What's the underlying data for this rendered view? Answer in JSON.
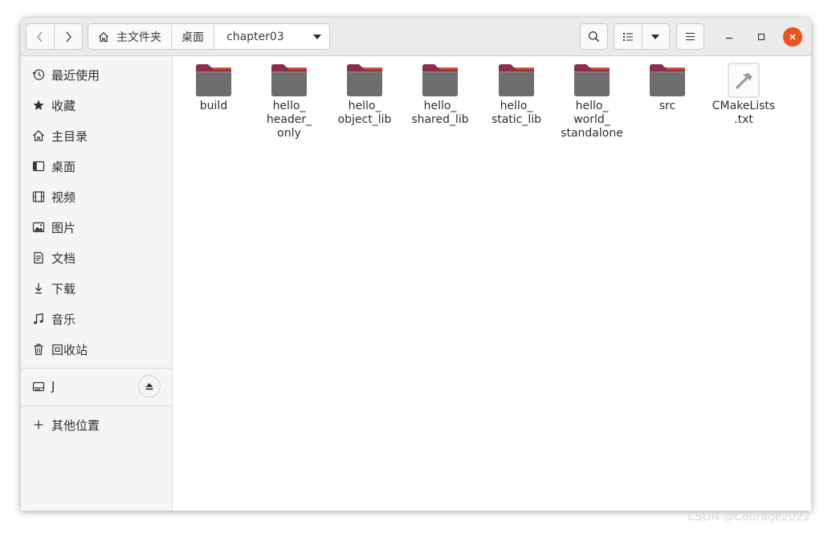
{
  "breadcrumb": {
    "home": "主文件夹",
    "desktop": "桌面",
    "current": "chapter03"
  },
  "sidebar": {
    "places": [
      {
        "label": "最近使用",
        "icon": "clock-icon"
      },
      {
        "label": "收藏",
        "icon": "star-icon"
      },
      {
        "label": "主目录",
        "icon": "home-icon"
      },
      {
        "label": "桌面",
        "icon": "desktop-icon"
      },
      {
        "label": "视频",
        "icon": "video-icon"
      },
      {
        "label": "图片",
        "icon": "picture-icon"
      },
      {
        "label": "文档",
        "icon": "document-icon"
      },
      {
        "label": "下载",
        "icon": "download-icon"
      },
      {
        "label": "音乐",
        "icon": "music-icon"
      },
      {
        "label": "回收站",
        "icon": "trash-icon"
      }
    ],
    "device": {
      "label": "J",
      "icon": "drive-icon"
    },
    "other": {
      "label": "其他位置",
      "icon": "plus-icon"
    }
  },
  "files": [
    {
      "name": "build",
      "lines": [
        "build"
      ],
      "type": "folder"
    },
    {
      "name": "hello_header_only",
      "lines": [
        "hello_",
        "header_",
        "only"
      ],
      "type": "folder"
    },
    {
      "name": "hello_object_lib",
      "lines": [
        "hello_",
        "object_lib"
      ],
      "type": "folder"
    },
    {
      "name": "hello_shared_lib",
      "lines": [
        "hello_",
        "shared_lib"
      ],
      "type": "folder"
    },
    {
      "name": "hello_static_lib",
      "lines": [
        "hello_",
        "static_lib"
      ],
      "type": "folder"
    },
    {
      "name": "hello_world_standalone",
      "lines": [
        "hello_",
        "world_",
        "standalone"
      ],
      "type": "folder"
    },
    {
      "name": "src",
      "lines": [
        "src"
      ],
      "type": "folder"
    },
    {
      "name": "CMakeLists.txt",
      "lines": [
        "CMakeLists",
        ".txt"
      ],
      "type": "file"
    }
  ],
  "watermark": "CSDN @Courage2022",
  "colors": {
    "accent": "#e95420",
    "folder_tab": "#8c2d4e",
    "folder_body": "#6d6d6d"
  }
}
